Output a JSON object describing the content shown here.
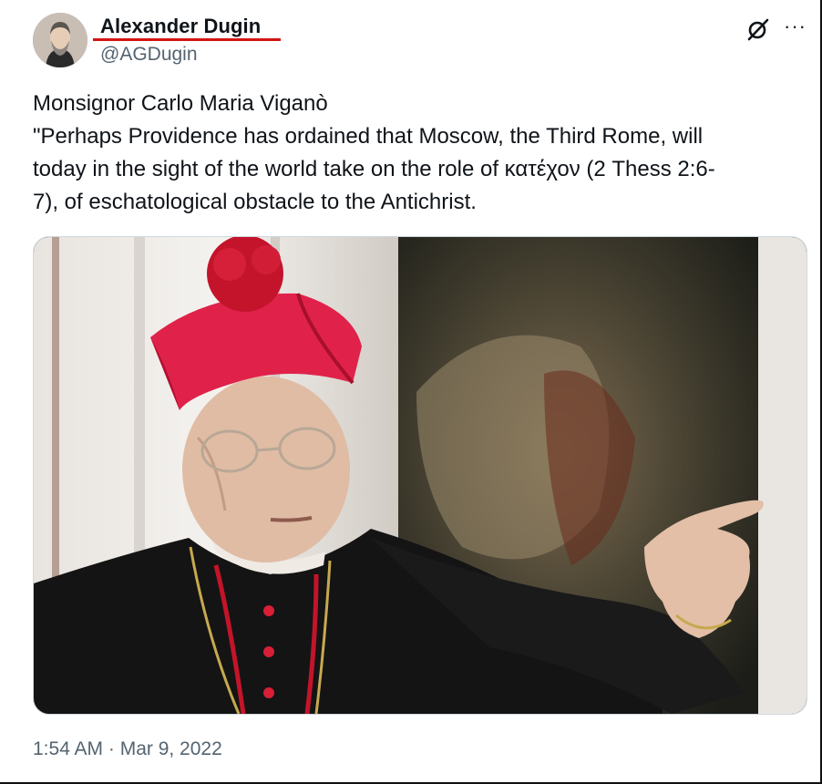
{
  "author": {
    "name": "Alexander Dugin",
    "handle": "@AGDugin",
    "avatar_icon": "profile-photo"
  },
  "header_icons": {
    "grok": "grok-icon",
    "more": "more-options-icon",
    "more_glyph": "···"
  },
  "tweet": {
    "lines": [
      "Monsignor Carlo Maria Viganò",
      "\"Perhaps Providence has ordained that Moscow, the Third Rome, will",
      "today in the sight of the world take on the role of κατέχον (2 Thess 2:6-",
      "7), of eschatological obstacle to the Antichrist."
    ]
  },
  "media": {
    "kind": "photo",
    "subject": "cleric-in-red-biretta-pointing"
  },
  "meta": {
    "timestamp": "1:54 AM · Mar 9, 2022"
  },
  "colors": {
    "text": "#0f1419",
    "secondary": "#536471",
    "underline": "#d41414",
    "biretta": "#e0224a",
    "cassock": "#141414"
  }
}
